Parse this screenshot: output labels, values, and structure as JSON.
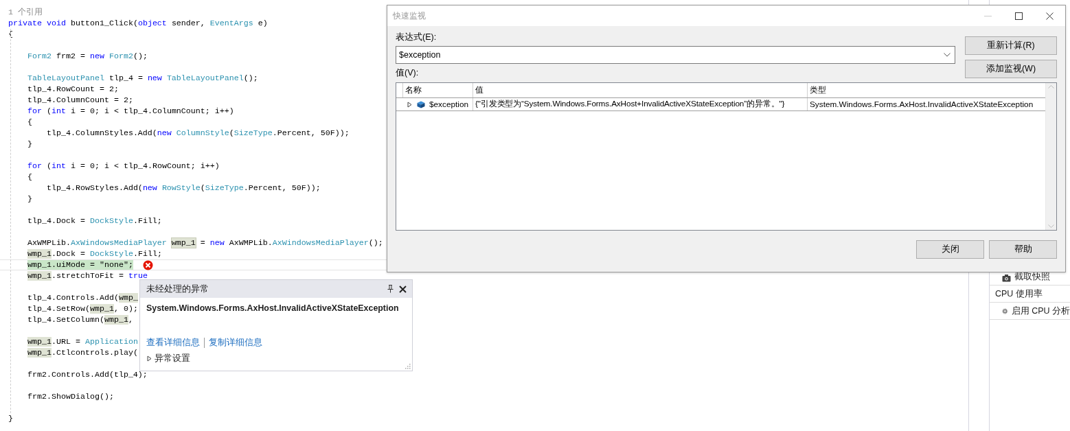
{
  "editor": {
    "codelens": "1 个引用",
    "blocks": [
      {
        "lines": [
          {
            "current": false,
            "tokens": [
              {
                "kind": "keyword",
                "text": "private"
              },
              {
                "kind": "keyword",
                "text": " void"
              },
              {
                "kind": "plain",
                "text": " button1_Click("
              },
              {
                "kind": "keyword",
                "text": "object"
              },
              {
                "kind": "plain",
                "text": " sender, "
              },
              {
                "kind": "type",
                "text": "EventArgs"
              },
              {
                "kind": "plain",
                "text": " e)"
              }
            ]
          },
          {
            "current": false,
            "tokens": [
              {
                "kind": "plain",
                "text": "{"
              }
            ]
          }
        ]
      },
      {
        "lines": [
          {
            "current": false,
            "tokens": [
              {
                "kind": "type",
                "text": "    Form2"
              },
              {
                "kind": "plain",
                "text": " frm2 = "
              },
              {
                "kind": "keyword",
                "text": "new"
              },
              {
                "kind": "type",
                "text": " Form2"
              },
              {
                "kind": "plain",
                "text": "();"
              }
            ]
          }
        ]
      },
      {
        "lines": [
          {
            "current": false,
            "tokens": [
              {
                "kind": "type",
                "text": "    TableLayoutPanel"
              },
              {
                "kind": "plain",
                "text": " tlp_4 = "
              },
              {
                "kind": "keyword",
                "text": "new"
              },
              {
                "kind": "type",
                "text": " TableLayoutPanel"
              },
              {
                "kind": "plain",
                "text": "();"
              }
            ]
          },
          {
            "current": false,
            "tokens": [
              {
                "kind": "plain",
                "text": "    tlp_4.RowCount = 2;"
              }
            ]
          },
          {
            "current": false,
            "tokens": [
              {
                "kind": "plain",
                "text": "    tlp_4.ColumnCount = 2;"
              }
            ]
          },
          {
            "current": false,
            "tokens": [
              {
                "kind": "keyword",
                "text": "    for"
              },
              {
                "kind": "plain",
                "text": " ("
              },
              {
                "kind": "keyword",
                "text": "int"
              },
              {
                "kind": "plain",
                "text": " i = 0; i < tlp_4.ColumnCount; i++)"
              }
            ]
          },
          {
            "current": false,
            "tokens": [
              {
                "kind": "plain",
                "text": "    {"
              }
            ]
          },
          {
            "current": false,
            "tokens": [
              {
                "kind": "plain",
                "text": "        tlp_4.ColumnStyles.Add("
              },
              {
                "kind": "keyword",
                "text": "new"
              },
              {
                "kind": "type",
                "text": " ColumnStyle"
              },
              {
                "kind": "plain",
                "text": "("
              },
              {
                "kind": "type",
                "text": "SizeType"
              },
              {
                "kind": "plain",
                "text": ".Percent, 50F));"
              }
            ]
          },
          {
            "current": false,
            "tokens": [
              {
                "kind": "plain",
                "text": "    }"
              }
            ]
          }
        ]
      },
      {
        "lines": [
          {
            "current": false,
            "tokens": [
              {
                "kind": "keyword",
                "text": "    for"
              },
              {
                "kind": "plain",
                "text": " ("
              },
              {
                "kind": "keyword",
                "text": "int"
              },
              {
                "kind": "plain",
                "text": " i = 0; i < tlp_4.RowCount; i++)"
              }
            ]
          },
          {
            "current": false,
            "tokens": [
              {
                "kind": "plain",
                "text": "    {"
              }
            ]
          },
          {
            "current": false,
            "tokens": [
              {
                "kind": "plain",
                "text": "        tlp_4.RowStyles.Add("
              },
              {
                "kind": "keyword",
                "text": "new"
              },
              {
                "kind": "type",
                "text": " RowStyle"
              },
              {
                "kind": "plain",
                "text": "("
              },
              {
                "kind": "type",
                "text": "SizeType"
              },
              {
                "kind": "plain",
                "text": ".Percent, 50F));"
              }
            ]
          },
          {
            "current": false,
            "tokens": [
              {
                "kind": "plain",
                "text": "    }"
              }
            ]
          }
        ]
      },
      {
        "lines": [
          {
            "current": false,
            "tokens": [
              {
                "kind": "plain",
                "text": "    tlp_4.Dock = "
              },
              {
                "kind": "type",
                "text": "DockStyle"
              },
              {
                "kind": "plain",
                "text": ".Fill;"
              }
            ]
          }
        ]
      },
      {
        "lines": [
          {
            "current": false,
            "tokens": [
              {
                "kind": "plain",
                "text": "    AxWMPLib."
              },
              {
                "kind": "type",
                "text": "AxWindowsMediaPlayer"
              },
              {
                "kind": "definition",
                "text": " wmp_1"
              },
              {
                "kind": "plain",
                "text": " = "
              },
              {
                "kind": "keyword",
                "text": "new"
              },
              {
                "kind": "plain",
                "text": " AxWMPLib."
              },
              {
                "kind": "type",
                "text": "AxWindowsMediaPlayer"
              },
              {
                "kind": "plain",
                "text": "();"
              }
            ]
          },
          {
            "current": false,
            "tokens": [
              {
                "kind": "reference",
                "text": "    wmp_1"
              },
              {
                "kind": "plain",
                "text": ".Dock = "
              },
              {
                "kind": "type",
                "text": "DockStyle"
              },
              {
                "kind": "plain",
                "text": ".Fill;"
              }
            ]
          },
          {
            "current": true,
            "tokens": [
              {
                "kind": "highlight",
                "text": "    wmp_1.uiMode = \"none\";"
              }
            ]
          },
          {
            "current": false,
            "tokens": [
              {
                "kind": "reference",
                "text": "    wmp_1"
              },
              {
                "kind": "plain",
                "text": ".stretchToFit = "
              },
              {
                "kind": "keyword",
                "text": "true"
              }
            ]
          }
        ]
      },
      {
        "lines": [
          {
            "current": false,
            "tokens": [
              {
                "kind": "plain",
                "text": "    tlp_4.Controls.Add("
              },
              {
                "kind": "reference",
                "text": "wmp_"
              }
            ]
          },
          {
            "current": false,
            "tokens": [
              {
                "kind": "plain",
                "text": "    tlp_4.SetRow("
              },
              {
                "kind": "reference",
                "text": "wmp_1"
              },
              {
                "kind": "plain",
                "text": ", 0);"
              }
            ]
          },
          {
            "current": false,
            "tokens": [
              {
                "kind": "plain",
                "text": "    tlp_4.SetColumn("
              },
              {
                "kind": "reference",
                "text": "wmp_1"
              },
              {
                "kind": "plain",
                "text": ","
              }
            ]
          }
        ]
      },
      {
        "lines": [
          {
            "current": false,
            "tokens": [
              {
                "kind": "reference",
                "text": "    wmp_1"
              },
              {
                "kind": "plain",
                "text": ".URL = "
              },
              {
                "kind": "type",
                "text": "Application"
              }
            ]
          },
          {
            "current": false,
            "tokens": [
              {
                "kind": "reference",
                "text": "    wmp_1"
              },
              {
                "kind": "plain",
                "text": ".Ctlcontrols.play("
              }
            ]
          }
        ]
      },
      {
        "lines": [
          {
            "current": false,
            "tokens": [
              {
                "kind": "plain",
                "text": "    frm2.Controls.Add(tlp_4);"
              }
            ]
          }
        ]
      },
      {
        "lines": [
          {
            "current": false,
            "tokens": [
              {
                "kind": "plain",
                "text": "    frm2.ShowDialog();"
              }
            ]
          }
        ]
      },
      {
        "lines": [
          {
            "current": false,
            "tokens": [
              {
                "kind": "plain",
                "text": "}"
              }
            ]
          }
        ]
      }
    ]
  },
  "diagnostics_panel": {
    "items": [
      {
        "kind": "action",
        "label": "截取快照"
      },
      {
        "kind": "header",
        "label": "CPU 使用率"
      },
      {
        "kind": "action",
        "label": "启用 CPU 分析"
      }
    ]
  },
  "quick_watch": {
    "title": "快速监视",
    "expression_label": "表达式(E):",
    "expression": "$exception",
    "value_label": "值(V):",
    "side_buttons": [
      "重新计算(R)",
      "添加监视(W)"
    ],
    "columns": [
      "名称",
      "值",
      "类型"
    ],
    "rows": [
      {
        "expanded": false,
        "name": "$exception",
        "value": "{\"引发类型为“System.Windows.Forms.AxHost+InvalidActiveXStateException”的异常。\"}",
        "type": "System.Windows.Forms.AxHost.InvalidActiveXStateException"
      }
    ],
    "footer_buttons": [
      "关闭",
      "帮助"
    ]
  },
  "exception_popup": {
    "title": "未经处理的异常",
    "exception_type": "System.Windows.Forms.AxHost.InvalidActiveXStateException",
    "links": [
      "查看详细信息",
      "复制详细信息"
    ],
    "settings": {
      "label": "异常设置",
      "expanded": false
    }
  }
}
